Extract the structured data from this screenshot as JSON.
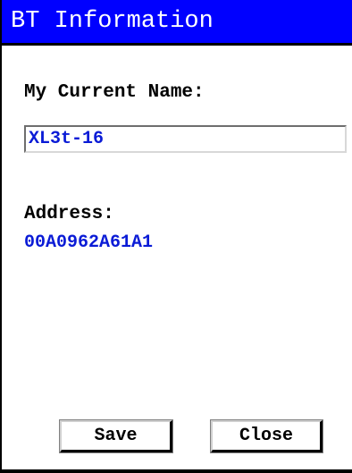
{
  "window": {
    "title": "BT Information"
  },
  "form": {
    "name_label": "My Current Name:",
    "name_value": "XL3t-16",
    "address_label": "Address:",
    "address_value": "00A0962A61A1"
  },
  "buttons": {
    "save_label": "Save",
    "close_label": "Close"
  },
  "colors": {
    "title_bg": "#0000ff",
    "title_fg": "#ffffff",
    "value_fg": "#0a1bd6"
  }
}
